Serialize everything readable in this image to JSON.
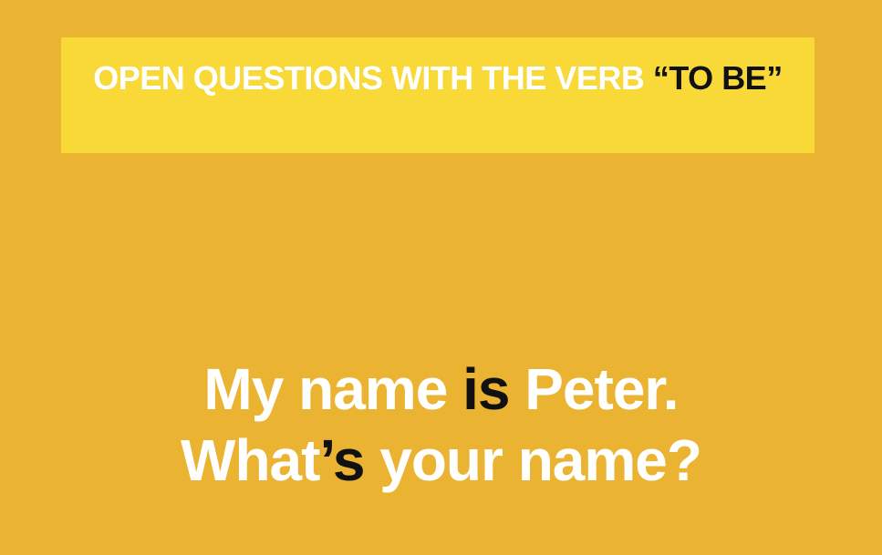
{
  "title": {
    "light_part": "OPEN QUESTIONS WITH THE VERB ",
    "dark_part": "“TO BE”"
  },
  "sentence1": {
    "before": "My name ",
    "highlight": "is",
    "after": " Peter."
  },
  "sentence2": {
    "before": "What",
    "highlight": "’s",
    "after": " your name?"
  },
  "colors": {
    "background": "#ebb332",
    "title_band": "#f8d938",
    "text_light": "#ffffff",
    "text_dark": "#111111"
  }
}
